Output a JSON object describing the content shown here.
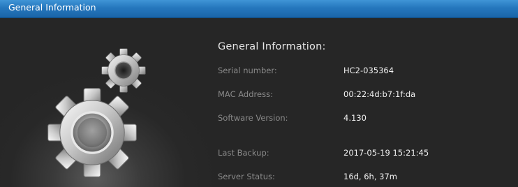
{
  "titlebar": {
    "title": "General Information"
  },
  "main": {
    "heading": "General Information:",
    "rows": [
      {
        "label": "Serial number:",
        "value": "HC2-035364"
      },
      {
        "label": "MAC Address:",
        "value": "00:22:4d:b7:1f:da"
      },
      {
        "label": "Software Version:",
        "value": "4.130"
      },
      {
        "label": "Last Backup:",
        "value": "2017-05-19 15:21:45"
      },
      {
        "label": "Server Status:",
        "value": "16d, 6h, 37m"
      }
    ]
  },
  "icons": {
    "gears": "gears-icon"
  },
  "colors": {
    "titlebar_blue": "#2577bd",
    "background": "#262626",
    "label_gray": "#8a8a8a",
    "value_white": "#f2f2f2"
  }
}
